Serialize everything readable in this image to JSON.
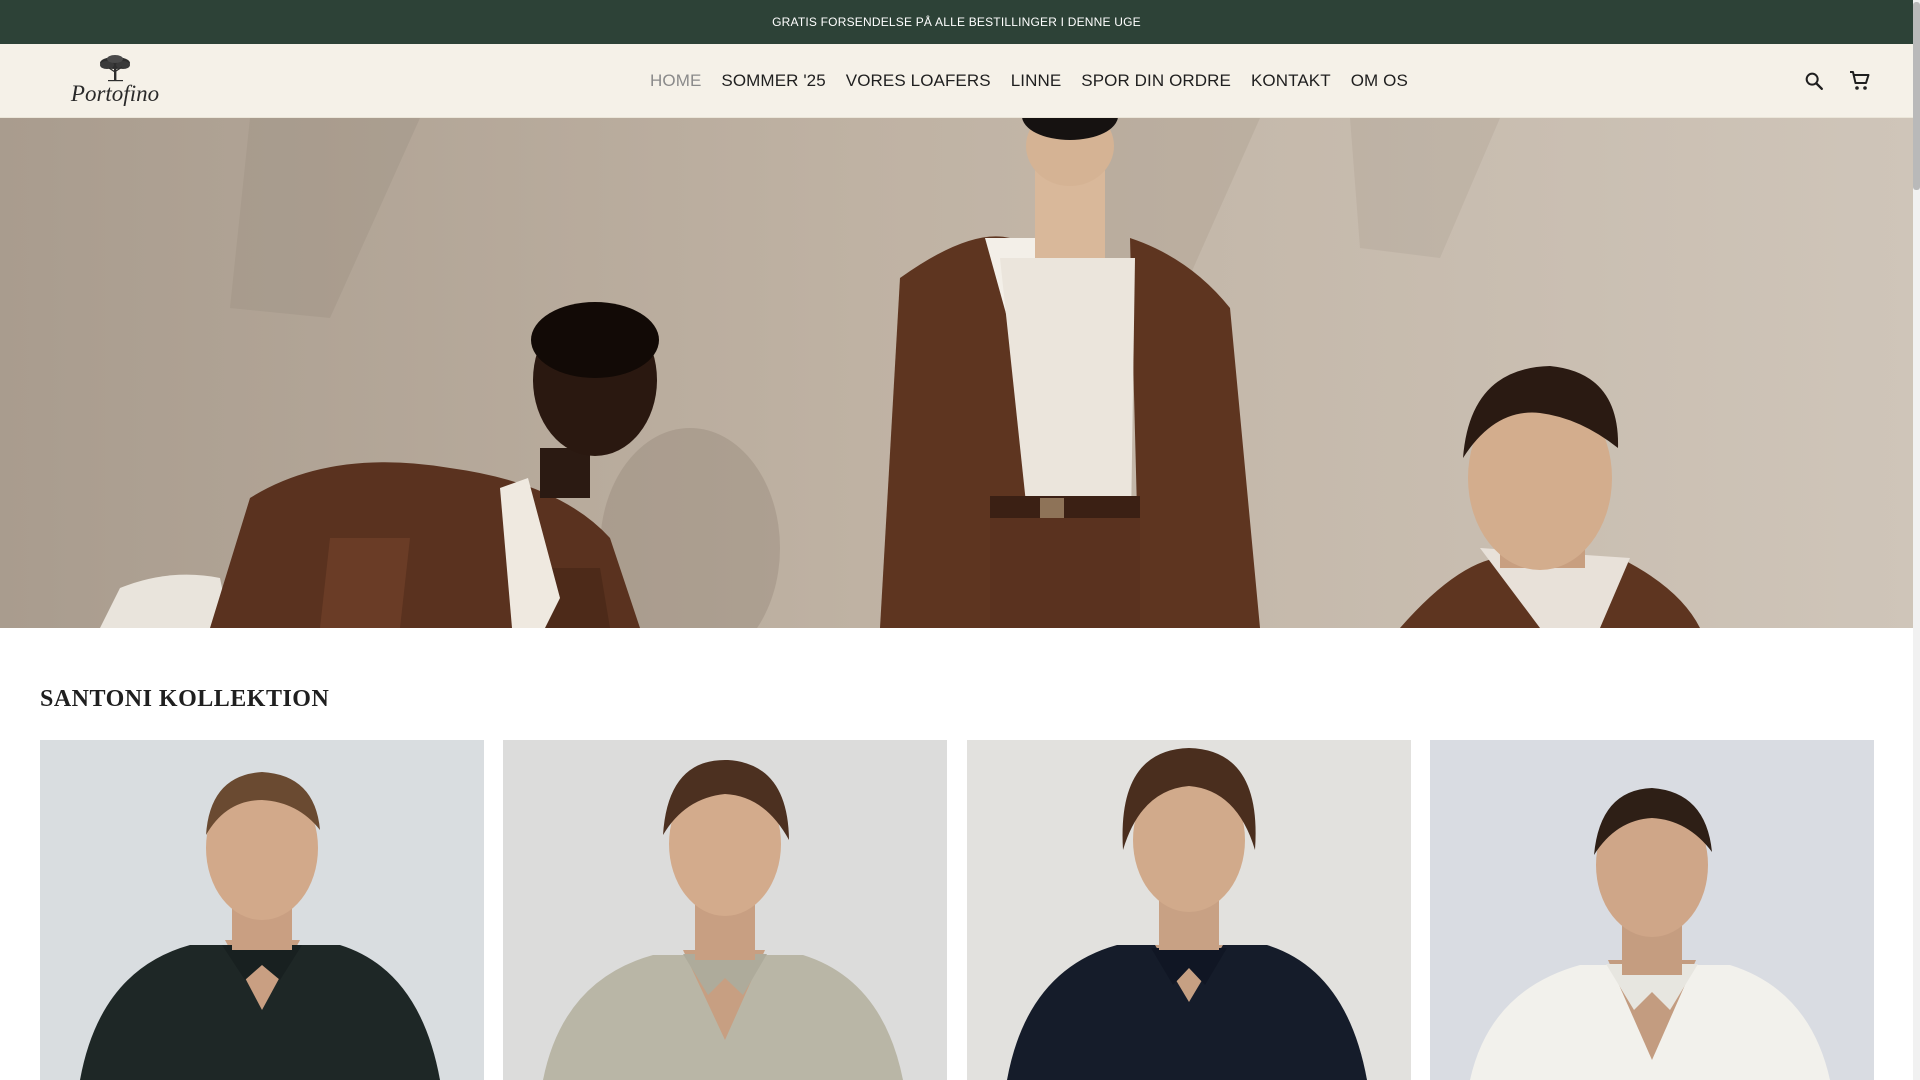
{
  "announcement": {
    "text": "GRATIS FORSENDELSE PÅ ALLE BESTILLINGER I DENNE UGE"
  },
  "header": {
    "logo_text": "Portofino",
    "nav": [
      {
        "label": "HOME",
        "active": true
      },
      {
        "label": "SOMMER '25",
        "active": false
      },
      {
        "label": "VORES LOAFERS",
        "active": false
      },
      {
        "label": "LINNE",
        "active": false
      },
      {
        "label": "SPOR DIN ORDRE",
        "active": false
      },
      {
        "label": "KONTAKT",
        "active": false
      },
      {
        "label": "OM OS",
        "active": false
      }
    ],
    "icons": [
      "search-icon",
      "cart-icon"
    ]
  },
  "collection": {
    "title": "SANTONI KOLLEKTION",
    "products": [
      {
        "shirt_color": "#1e2726"
      },
      {
        "shirt_color": "#b9b6a6"
      },
      {
        "shirt_color": "#151c2a"
      },
      {
        "shirt_color": "#f2f1ec"
      }
    ]
  },
  "colors": {
    "announcement_bg": "#2d4237",
    "header_bg": "#f5f1e8",
    "hero_bg": "#bdb0a1",
    "suit_brown": "#5e3520"
  }
}
